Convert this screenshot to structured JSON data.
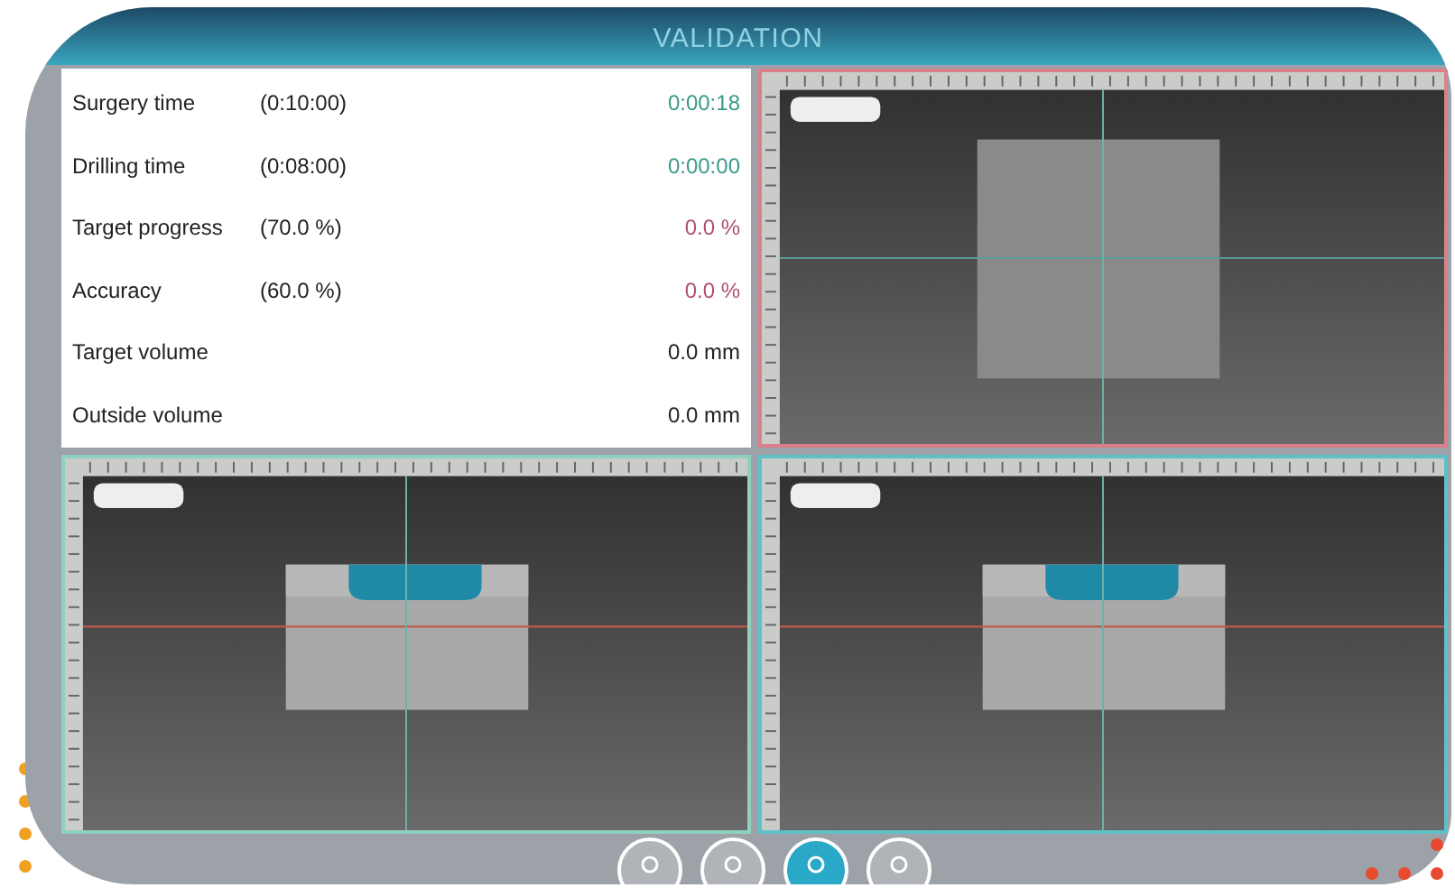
{
  "header": {
    "title": "VALIDATION"
  },
  "stats": [
    {
      "label": "Surgery time",
      "target": "(0:10:00)",
      "value": "0:00:18",
      "color": "#3a9a8a"
    },
    {
      "label": "Drilling time",
      "target": "(0:08:00)",
      "value": "0:00:00",
      "color": "#3a9a8a"
    },
    {
      "label": "Target progress",
      "target": "(70.0 %)",
      "value": "0.0 %",
      "color": "#b0506a"
    },
    {
      "label": "Accuracy",
      "target": "(60.0 %)",
      "value": "0.0 %",
      "color": "#b0506a"
    },
    {
      "label": "Target volume",
      "value": "0.0 mm",
      "color": "#222222"
    },
    {
      "label": "Outside volume",
      "value": "0.0 mm",
      "color": "#222222"
    }
  ],
  "viewports": [
    {
      "color": "#d9808a",
      "drilled": false
    },
    {
      "color": "#8fd0c0",
      "drilled": true
    },
    {
      "color": "#5fc0c8",
      "drilled": true
    }
  ],
  "toolbar": [
    {
      "selected": false
    },
    {
      "selected": false
    },
    {
      "selected": true
    },
    {
      "selected": false
    }
  ]
}
